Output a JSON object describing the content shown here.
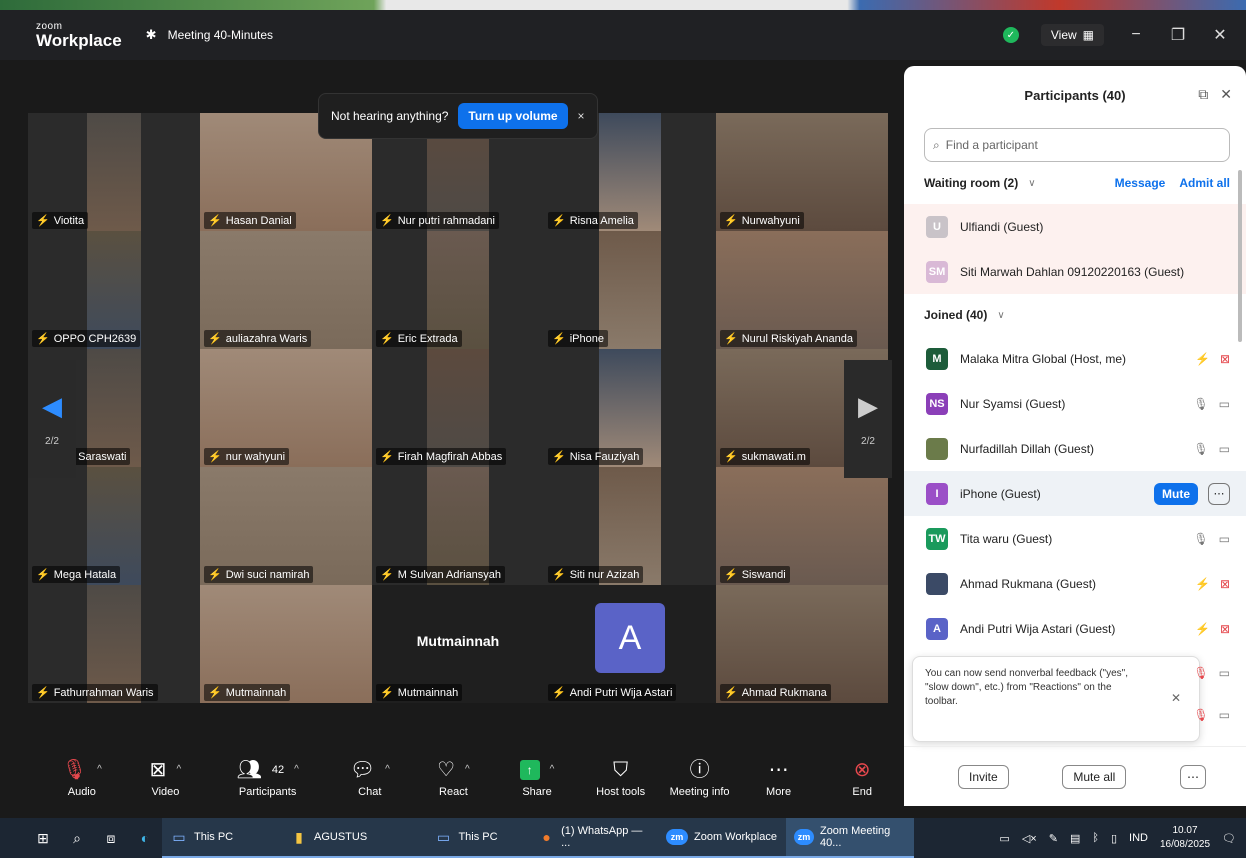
{
  "titlebar": {
    "brand_top": "zoom",
    "brand_bottom": "Workplace",
    "meeting_title": "Meeting 40-Minutes",
    "view_label": "View"
  },
  "toast": {
    "message": "Not hearing anything?",
    "button": "Turn up volume",
    "close": "×"
  },
  "tiles": [
    {
      "name": "Viotita"
    },
    {
      "name": "Hasan Danial"
    },
    {
      "name": "Nur putri rahmadani"
    },
    {
      "name": "Risna Amelia"
    },
    {
      "name": "Nurwahyuni"
    },
    {
      "name": "OPPO CPH2639"
    },
    {
      "name": "auliazahra Waris"
    },
    {
      "name": "Eric Extrada"
    },
    {
      "name": "iPhone"
    },
    {
      "name": "Nurul Riskiyah Ananda"
    },
    {
      "name": "Suci Saraswati"
    },
    {
      "name": "nur wahyuni"
    },
    {
      "name": "Firah Magfirah Abbas"
    },
    {
      "name": "Nisa Fauziyah"
    },
    {
      "name": "sukmawati.m"
    },
    {
      "name": "Mega Hatala"
    },
    {
      "name": "Dwi suci namirah"
    },
    {
      "name": "M Sulvan Adriansyah"
    },
    {
      "name": "Siti nur Azizah"
    },
    {
      "name": "Siswandi"
    },
    {
      "name": "Fathurrahman Waris"
    },
    {
      "name": "Mutmainnah"
    },
    {
      "name": "Mutmainnah",
      "center_label": "Mutmainnah"
    },
    {
      "name": "Andi Putri Wija Astari",
      "avatar_letter": "A"
    },
    {
      "name": "Ahmad Rukmana"
    }
  ],
  "pager": {
    "left": "2/2",
    "right": "2/2"
  },
  "toolbar": {
    "audio": "Audio",
    "video": "Video",
    "participants": "Participants",
    "participants_count": "42",
    "chat": "Chat",
    "react": "React",
    "share": "Share",
    "host_tools": "Host tools",
    "meeting_info": "Meeting info",
    "more": "More",
    "end": "End"
  },
  "panel": {
    "title": "Participants (40)",
    "search_placeholder": "Find a participant",
    "waiting_room": "Waiting room (2)",
    "message": "Message",
    "admit_all": "Admit all",
    "waiting": [
      {
        "initials": "U",
        "name": "Ulfiandi (Guest)",
        "color": "#c9c3c8"
      },
      {
        "initials": "SM",
        "name": "Siti Marwah Dahlan 09120220163 (Guest)",
        "color": "#d9b9d6"
      }
    ],
    "joined": "Joined (40)",
    "participants": [
      {
        "initials": "M",
        "name": "Malaka Mitra Global (Host, me)",
        "color": "#1d5c3a",
        "mic": "off",
        "cam": "off"
      },
      {
        "initials": "NS",
        "name": "Nur Syamsi (Guest)",
        "color": "#8b3fb8",
        "mic": "on",
        "cam": "on"
      },
      {
        "initials": "",
        "name": "Nurfadillah Dillah (Guest)",
        "color": "#6b7b4a",
        "mic": "on",
        "cam": "on"
      },
      {
        "initials": "I",
        "name": "iPhone (Guest)",
        "color": "#9b4fc7",
        "mic": "",
        "cam": ""
      },
      {
        "initials": "TW",
        "name": "Tita waru (Guest)",
        "color": "#1a9a5c",
        "mic": "on",
        "cam": "on"
      },
      {
        "initials": "",
        "name": "Ahmad Rukmana (Guest)",
        "color": "#3b4a66",
        "mic": "off",
        "cam": "off"
      },
      {
        "initials": "A",
        "name": "Andi Putri Wija Astari (Guest)",
        "color": "#5a63c7",
        "mic": "off",
        "cam": "off"
      }
    ],
    "mute_label": "Mute",
    "tip": "You can now send nonverbal feedback (\"yes\", \"slow down\", etc.) from \"Reactions\" on the toolbar.",
    "invite": "Invite",
    "mute_all": "Mute all"
  },
  "taskbar": {
    "items": [
      "This PC",
      "AGUSTUS",
      "This PC",
      "(1) WhatsApp — ...",
      "Zoom Workplace",
      "Zoom Meeting 40..."
    ],
    "lang": "IND",
    "time": "10.07",
    "date": "16/08/2025"
  }
}
